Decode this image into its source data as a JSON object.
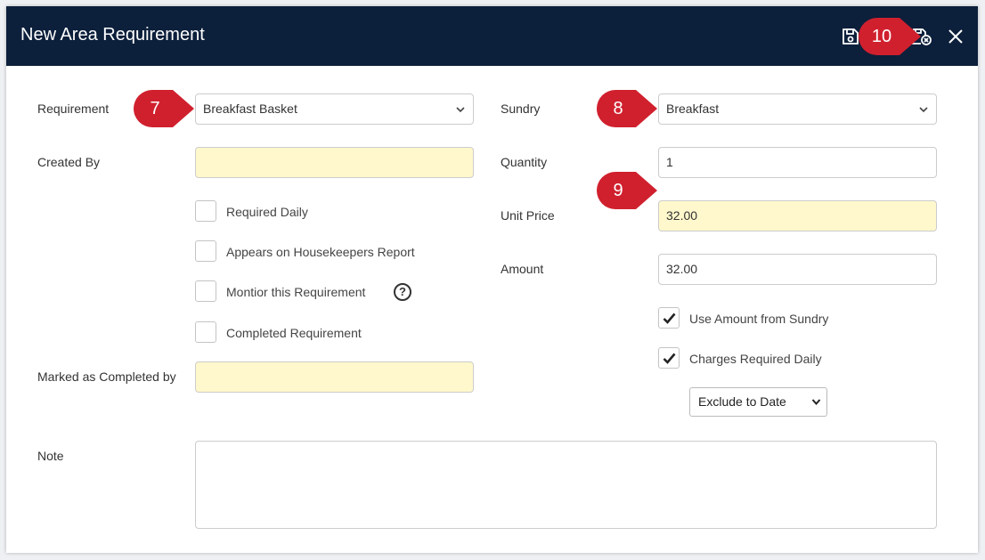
{
  "dialog": {
    "title": "New Area Requirement",
    "accent": "#0c1f3b",
    "required_field_color": "#fff8cc",
    "toolbar": {
      "save_icon": "save-icon",
      "save_close_icon": "save-close-icon",
      "close_icon": "close-icon"
    }
  },
  "left": {
    "requirement_label": "Requirement",
    "requirement_value": "Breakfast Basket",
    "created_by_label": "Created By",
    "created_by_value": "",
    "checkboxes": [
      {
        "label": "Required Daily",
        "checked": false
      },
      {
        "label": "Appears on Housekeepers Report",
        "checked": false
      },
      {
        "label": "Montior this Requirement",
        "checked": false
      },
      {
        "label": "Completed Requirement",
        "checked": false
      }
    ],
    "help_glyph": "?",
    "marked_completed_label": "Marked as Completed by",
    "marked_completed_value": ""
  },
  "right": {
    "sundry_label": "Sundry",
    "sundry_value": "Breakfast",
    "quantity_label": "Quantity",
    "quantity_value": "1",
    "unit_price_label": "Unit Price",
    "unit_price_value": "32.00",
    "amount_label": "Amount",
    "amount_value": "32.00",
    "checkboxes": [
      {
        "label": "Use Amount from Sundry",
        "checked": true
      },
      {
        "label": "Charges Required Daily",
        "checked": true
      }
    ],
    "exclude_value": "Exclude to Date"
  },
  "note": {
    "label": "Note",
    "value": ""
  },
  "markers": [
    "7",
    "8",
    "9",
    "10"
  ],
  "marker_color": "#d0202e"
}
